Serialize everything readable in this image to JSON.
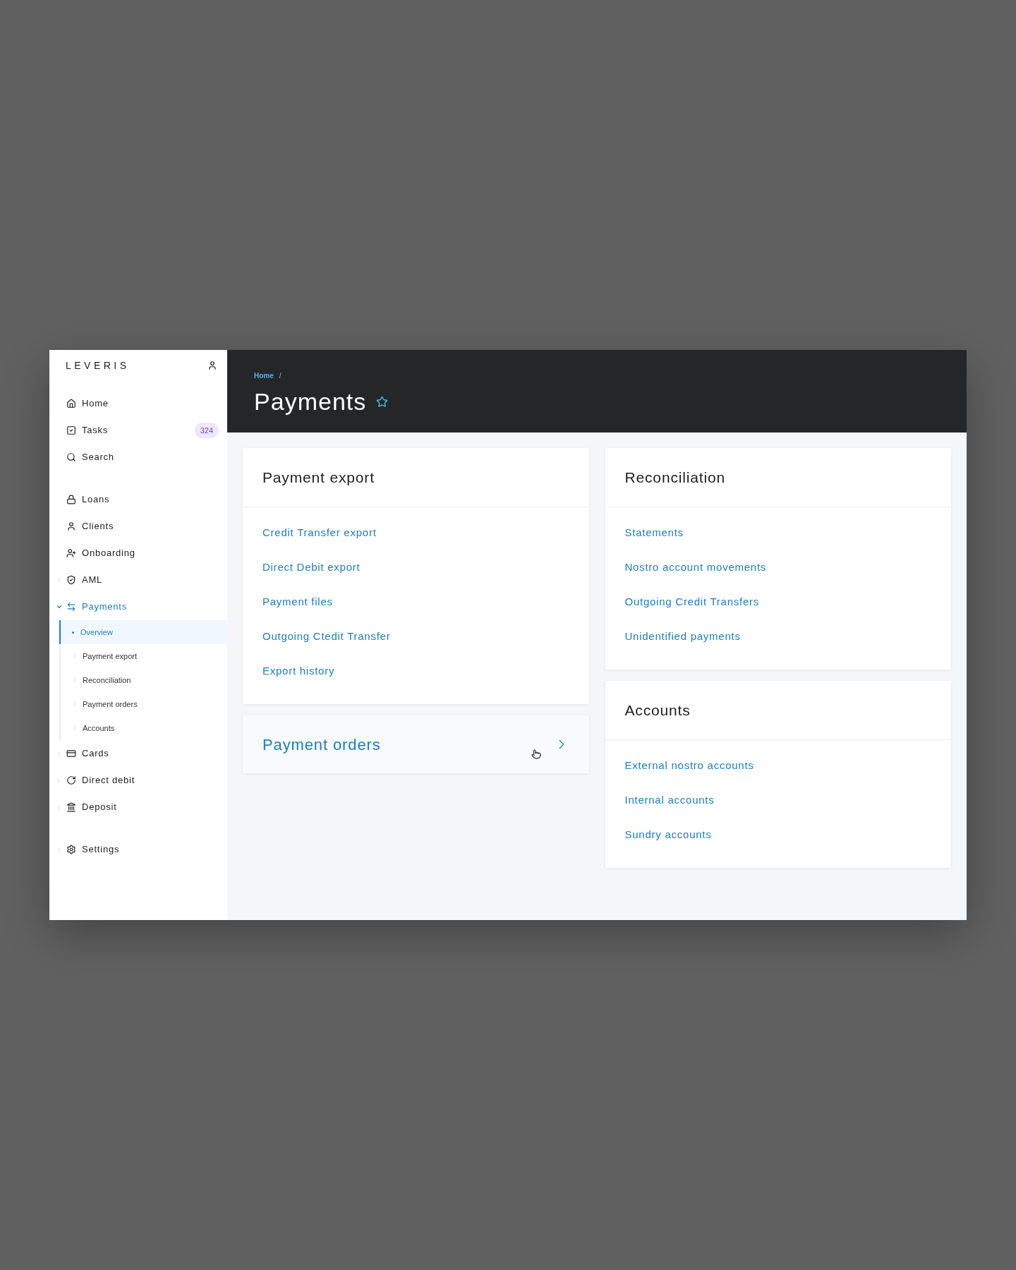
{
  "sidebar": {
    "logo": "LEVERIS",
    "groups": [
      {
        "items": [
          {
            "label": "Home",
            "kind": "link",
            "selected": false
          },
          {
            "label": "Tasks",
            "kind": "link",
            "selected": false,
            "badge": "324"
          },
          {
            "label": "Search",
            "kind": "link",
            "selected": false
          }
        ]
      },
      {
        "items": [
          {
            "label": "Loans",
            "kind": "link",
            "selected": false
          },
          {
            "label": "Clients",
            "kind": "link",
            "selected": false
          },
          {
            "label": "Onboarding",
            "kind": "link",
            "selected": false
          },
          {
            "label": "AML",
            "kind": "group",
            "expanded": false,
            "selected": false
          },
          {
            "label": "Payments",
            "kind": "group",
            "expanded": true,
            "selected": true,
            "children": [
              {
                "label": "Overview",
                "selected": true
              },
              {
                "label": "Payment export",
                "selected": false
              },
              {
                "label": "Reconciliation",
                "selected": false
              },
              {
                "label": "Payment orders",
                "selected": false
              },
              {
                "label": "Accounts",
                "selected": false
              }
            ]
          },
          {
            "label": "Cards",
            "kind": "group",
            "expanded": false,
            "selected": false
          },
          {
            "label": "Direct debit",
            "kind": "group",
            "expanded": false,
            "selected": false
          },
          {
            "label": "Deposit",
            "kind": "group",
            "expanded": false,
            "selected": false
          }
        ]
      },
      {
        "items": [
          {
            "label": "Settings",
            "kind": "group",
            "expanded": false,
            "selected": false
          }
        ]
      }
    ]
  },
  "header": {
    "breadcrumb": [
      "Home",
      "/"
    ],
    "title": "Payments",
    "favorite": false
  },
  "columns": [
    {
      "cards": [
        {
          "kind": "list",
          "title": "Payment export",
          "links": [
            "Credit Transfer export",
            "Direct Debit export",
            "Payment files",
            "Outgoing Ctedit Transfer",
            "Export history"
          ]
        },
        {
          "kind": "link",
          "title": "Payment orders"
        }
      ]
    },
    {
      "cards": [
        {
          "kind": "list",
          "title": "Reconciliation",
          "links": [
            "Statements",
            "Nostro account movements",
            "Outgoing Credit Transfers",
            "Unidentified payments"
          ]
        },
        {
          "kind": "list",
          "title": "Accounts",
          "links": [
            "External nostro accounts",
            "Internal accounts",
            "Sundry accounts"
          ]
        }
      ]
    }
  ]
}
